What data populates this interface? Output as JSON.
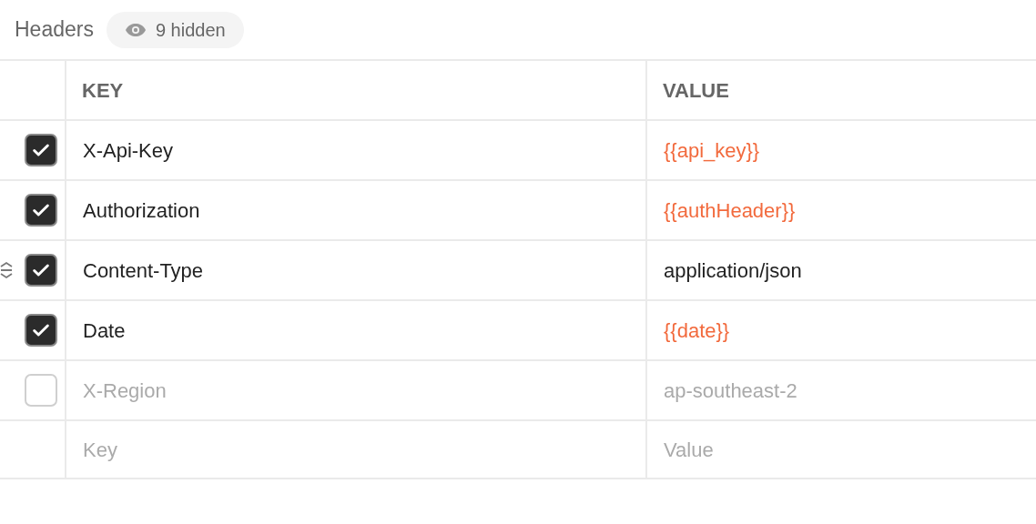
{
  "section": {
    "title": "Headers",
    "hidden_badge": "9 hidden"
  },
  "table": {
    "columns": [
      "KEY",
      "VALUE"
    ],
    "rows": [
      {
        "key": "X-Api-Key",
        "value": "{{api_key}}",
        "kind": "variable",
        "checked": true,
        "hovered": false
      },
      {
        "key": "Authorization",
        "value": "{{authHeader}}",
        "kind": "variable",
        "checked": true,
        "hovered": false
      },
      {
        "key": "Content-Type",
        "value": "application/json",
        "kind": "text",
        "checked": true,
        "hovered": true
      },
      {
        "key": "Date",
        "value": "{{date}}",
        "kind": "variable",
        "checked": true,
        "hovered": false
      },
      {
        "key": "X-Region",
        "value": "ap-southeast-2",
        "kind": "text",
        "checked": false,
        "hovered": false
      }
    ],
    "new_row": {
      "key_placeholder": "Key",
      "value_placeholder": "Value"
    }
  }
}
